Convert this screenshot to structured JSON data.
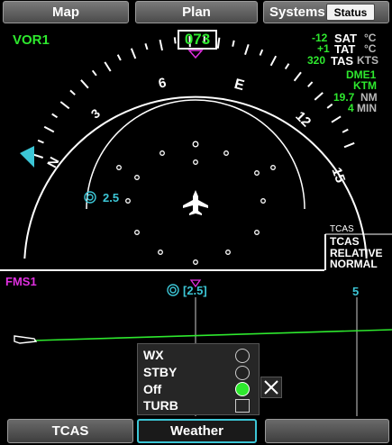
{
  "tabs": {
    "map": "Map",
    "plan": "Plan",
    "systems": "Systems",
    "status": "Status"
  },
  "nav_source": "VOR1",
  "heading": "073",
  "air_data": {
    "sat_value": "-12",
    "sat_label": "SAT",
    "sat_unit": "°C",
    "tat_value": "+1",
    "tat_label": "TAT",
    "tat_unit": "°C",
    "tas_value": "320",
    "tas_label": "TAS",
    "tas_unit": "KTS"
  },
  "dme": {
    "source": "DME1",
    "station": "KTM",
    "distance": "19.7",
    "distance_unit": "NM",
    "time": "4",
    "time_unit": "MIN"
  },
  "compass_labels": {
    "n": "N",
    "three": "3",
    "six": "6",
    "e": "E",
    "twelve": "12",
    "fifteen": "15"
  },
  "range_label": "2.5",
  "tcas": {
    "header": "TCAS",
    "line1": "TCAS",
    "line2": "RELATIVE",
    "line3": "NORMAL"
  },
  "vsd": {
    "source": "FMS1",
    "range_label": "[2.5]",
    "range_right": "5"
  },
  "weather_menu": {
    "wx": "WX",
    "stby": "STBY",
    "off": "Off",
    "turb": "TURB",
    "selected": "Off"
  },
  "bottom_tabs": {
    "tcas": "TCAS",
    "weather": "Weather"
  },
  "colors": {
    "green": "#2ee82e",
    "cyan": "#3cc6d6",
    "magenta": "#e030e0",
    "menu_bg": "#262626"
  }
}
